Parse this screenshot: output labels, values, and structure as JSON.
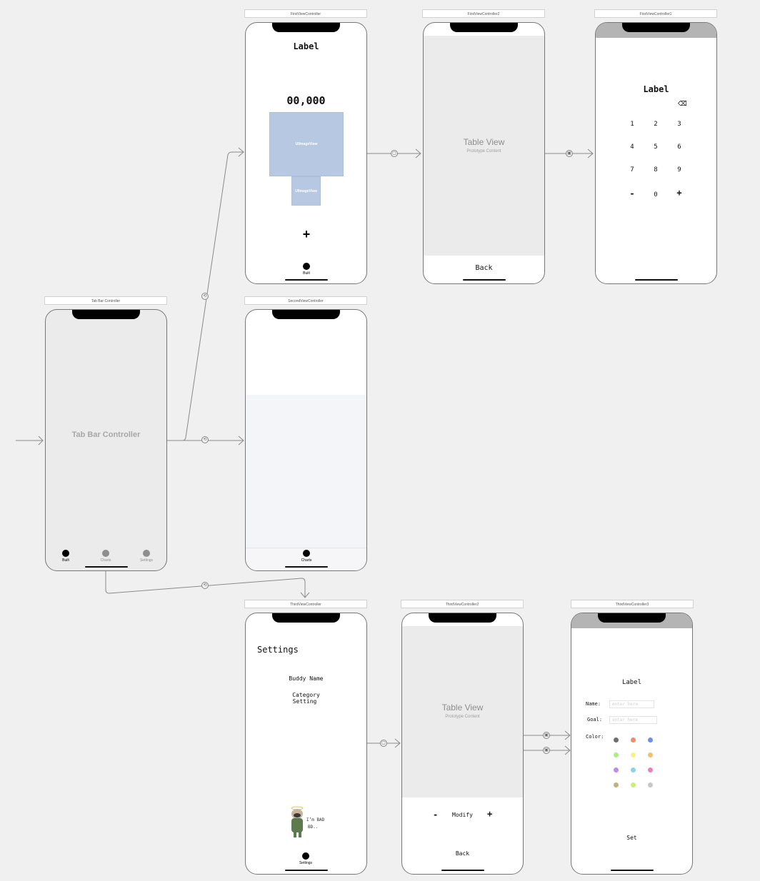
{
  "scenes": {
    "first": {
      "title": "FirstViewController",
      "label": "Label",
      "amount": "00,000",
      "image_big": "UIImageView",
      "image_small": "UIImageView",
      "plus": "+",
      "tab_label": "Built"
    },
    "first2": {
      "title": "FirstViewController2",
      "table_title": "Table View",
      "table_sub": "Prototype Content",
      "back": "Back"
    },
    "first1": {
      "title": "FirstViewController1",
      "label": "Label",
      "keys": [
        "1",
        "2",
        "3",
        "4",
        "5",
        "6",
        "7",
        "8",
        "9",
        "-",
        "0",
        "+"
      ],
      "delete_icon": "delete-backspace-icon"
    },
    "tabbar": {
      "title": "Tab Bar Controller",
      "center_text": "Tab Bar Controller",
      "tabs": [
        "Built",
        "Charts",
        "Settings"
      ]
    },
    "second": {
      "title": "SecondViewController",
      "tab_label": "Charts"
    },
    "third": {
      "title": "ThirdViewController",
      "heading": "Settings",
      "menu1": "Buddy Name",
      "menu2a": "Category",
      "menu2b": "Setting",
      "mascot_text1": "I’m BAD",
      "mascot_text2": "BD..",
      "tab_label": "Settings"
    },
    "third2": {
      "title": "ThirdViewController2",
      "table_title": "Table View",
      "table_sub": "Prototype Content",
      "minus": "-",
      "modify": "Modify",
      "plus": "+",
      "back": "Back"
    },
    "third3": {
      "title": "ThirdViewController3",
      "label": "Label",
      "name_label": "Name:",
      "name_placeholder": "enter here",
      "goal_label": "Goal:",
      "goal_placeholder": "enter here",
      "color_label": "Color:",
      "set": "Set",
      "colors": [
        "#6e6e6e",
        "#ef8c6a",
        "#6c8ef0",
        "#a7f07a",
        "#f7f283",
        "#f3c06c",
        "#c386f2",
        "#89d2ea",
        "#ef7ec0",
        "#bfb27b",
        "#c7f07a",
        "#c8c8c8"
      ]
    }
  },
  "ui": {
    "accent": "#000000",
    "inactive_tab": "#8e8e8e",
    "canvas_bg": "#f0f0f0"
  }
}
